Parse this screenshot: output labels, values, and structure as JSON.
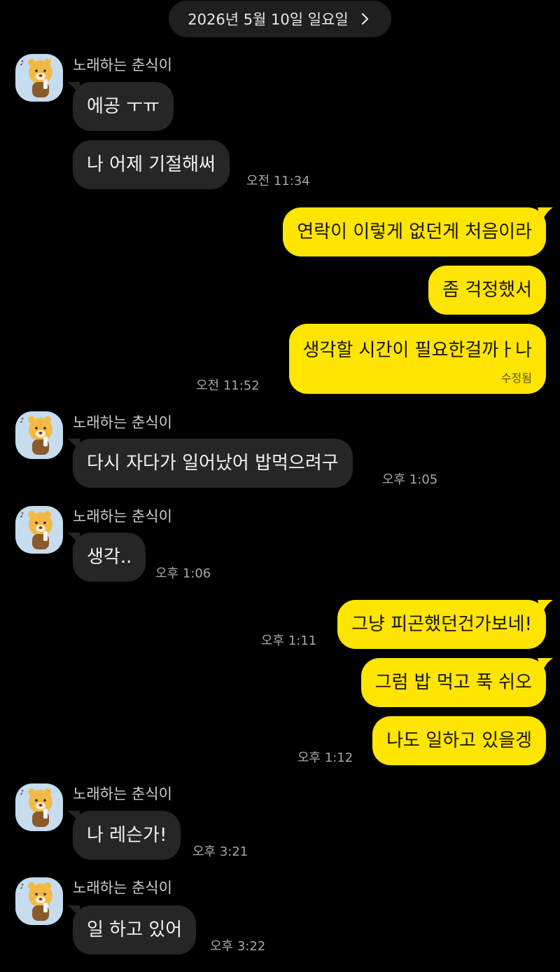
{
  "date_header": "2026년 5월 10일 일요일",
  "sender_name": "노래하는 춘식이",
  "messages": {
    "m1": {
      "text": "에공 ㅜㅠ"
    },
    "m2": {
      "text": "나 어제 기절해써",
      "time": "오전 11:34"
    },
    "m3": {
      "text": "연락이 이렇게 없던게 처음이라"
    },
    "m4": {
      "text": "좀 걱정했서"
    },
    "m5": {
      "text": "생각할 시간이 필요한걸까ㅏ나",
      "edited": "수정됨",
      "time": "오전 11:52"
    },
    "m6": {
      "text": "다시 자다가 일어났어 밥먹으려구",
      "time": "오후 1:05"
    },
    "m7": {
      "text": "생각..",
      "time": "오후 1:06"
    },
    "m8": {
      "text": "그냥 피곤했던건가보네!",
      "time": "오후 1:11"
    },
    "m9": {
      "text": "그럼 밥 먹고 푹 쉬오"
    },
    "m10": {
      "text": "나도 일하고 있을겡",
      "time": "오후 1:12"
    },
    "m11": {
      "text": "나 레슨가!",
      "time": "오후 3:21"
    },
    "m12": {
      "text": "일 하고 있어",
      "time": "오후 3:22"
    }
  },
  "colors": {
    "background": "#000000",
    "incoming_bubble": "#262626",
    "outgoing_bubble": "#ffe500",
    "avatar_bg": "#c6dcef"
  },
  "icons": {
    "date_chevron": "chevron-right-icon",
    "avatar": "singing-character-avatar"
  }
}
